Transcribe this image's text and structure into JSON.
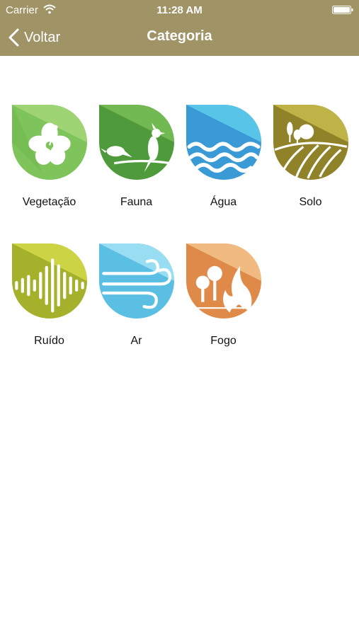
{
  "status_bar": {
    "carrier": "Carrier",
    "time": "11:28 AM"
  },
  "nav": {
    "back_label": "Voltar",
    "title": "Categoria"
  },
  "categories": [
    {
      "label": "Vegetação",
      "icon": "hibiscus-flower-icon",
      "color": "#7ec45a"
    },
    {
      "label": "Fauna",
      "icon": "bird-on-branch-icon",
      "color": "#4f9a3b"
    },
    {
      "label": "Água",
      "icon": "water-waves-icon",
      "color": "#3a9ad6"
    },
    {
      "label": "Solo",
      "icon": "fields-landscape-icon",
      "color": "#b2a43a"
    },
    {
      "label": "Ruído",
      "icon": "sound-wave-icon",
      "color": "#b7c236"
    },
    {
      "label": "Ar",
      "icon": "wind-icon",
      "color": "#5fc8e8"
    },
    {
      "label": "Fogo",
      "icon": "fire-trees-icon",
      "color": "#e6955a"
    }
  ]
}
